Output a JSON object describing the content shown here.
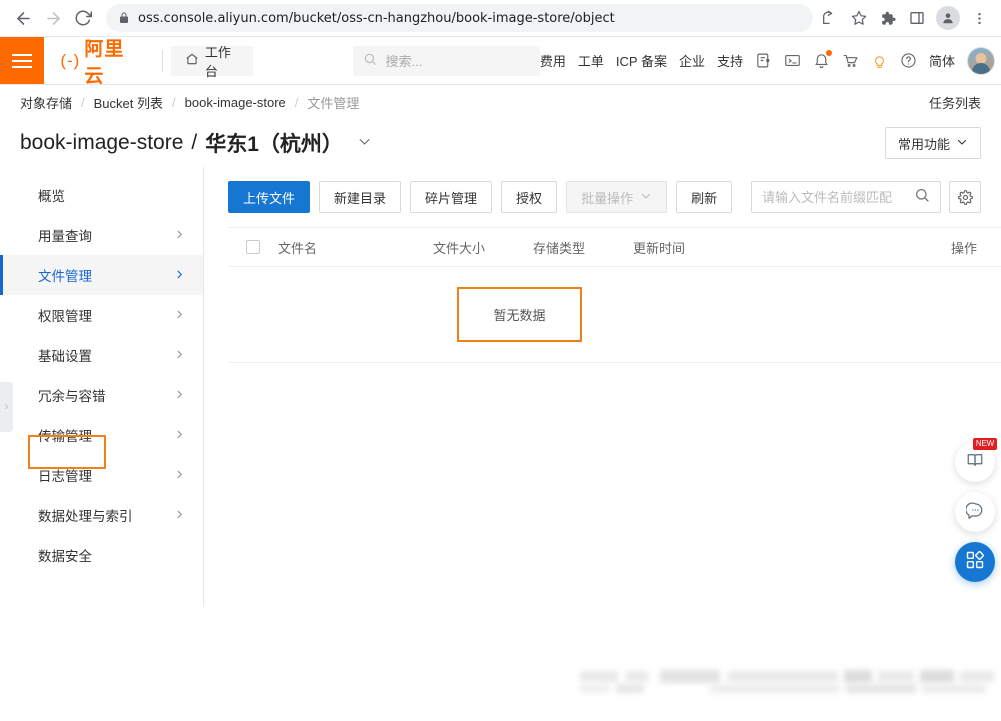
{
  "browser": {
    "back_label": "back-arrow",
    "forward_label": "forward-arrow",
    "reload_label": "reload",
    "url": "oss.console.aliyun.com/bucket/oss-cn-hangzhou/book-image-store/object",
    "lock_icon": "lock-icon",
    "share_icon": "share-icon",
    "bookmark_icon": "star-icon",
    "extensions_icon": "puzzle-icon",
    "sidepanel_icon": "side-panel-icon",
    "profile_icon": "profile-avatar-icon",
    "menu_icon": "three-dot-menu-icon"
  },
  "header": {
    "menu_icon": "hamburger-icon",
    "logo_text": "阿里云",
    "workbench": "工作台",
    "search_placeholder": "搜索...",
    "links": [
      "费用",
      "工单",
      "ICP 备案",
      "企业",
      "支持"
    ],
    "lang": "简体",
    "icons": [
      "app-icon",
      "terminal-icon",
      "bell-icon",
      "cart-icon",
      "lightbulb-icon",
      "help-icon"
    ]
  },
  "breadcrumb": {
    "items": [
      "对象存储",
      "Bucket 列表",
      "book-image-store",
      "文件管理"
    ],
    "separator": "/",
    "task_list": "任务列表"
  },
  "page": {
    "bucket_name": "book-image-store",
    "separator": "/",
    "region": "华东1（杭州）",
    "caret": "chevron-down-icon",
    "common_functions": "常用功能"
  },
  "sidebar": {
    "items": [
      {
        "label": "概览",
        "has_chevron": false,
        "active": false
      },
      {
        "label": "用量查询",
        "has_chevron": true,
        "active": false
      },
      {
        "label": "文件管理",
        "has_chevron": true,
        "active": true
      },
      {
        "label": "权限管理",
        "has_chevron": true,
        "active": false
      },
      {
        "label": "基础设置",
        "has_chevron": true,
        "active": false
      },
      {
        "label": "冗余与容错",
        "has_chevron": true,
        "active": false
      },
      {
        "label": "传输管理",
        "has_chevron": true,
        "active": false
      },
      {
        "label": "日志管理",
        "has_chevron": true,
        "active": false
      },
      {
        "label": "数据处理与索引",
        "has_chevron": true,
        "active": false
      },
      {
        "label": "数据安全",
        "has_chevron": false,
        "active": false
      }
    ],
    "collapse_handle": "›"
  },
  "toolbar": {
    "upload": "上传文件",
    "new_folder": "新建目录",
    "fragment_mgmt": "碎片管理",
    "authorize": "授权",
    "batch_ops": "批量操作",
    "refresh": "刷新",
    "search_placeholder": "请输入文件名前缀匹配",
    "search_value": "",
    "settings_icon": "gear-icon"
  },
  "table": {
    "columns": [
      "文件名",
      "文件大小",
      "存储类型",
      "更新时间",
      "操作"
    ],
    "rows": [],
    "empty_text": "暂无数据"
  },
  "fabs": [
    {
      "icon": "doc-book-icon",
      "badge": "NEW",
      "style": "white"
    },
    {
      "icon": "chat-bubble-icon",
      "badge": "",
      "style": "white"
    },
    {
      "icon": "qr-grid-icon",
      "badge": "",
      "style": "blue"
    }
  ],
  "colors": {
    "brand_orange": "#ff6a00",
    "primary_blue": "#1677d2",
    "annotation_orange": "#f0801a",
    "active_blue": "#1966d2"
  }
}
